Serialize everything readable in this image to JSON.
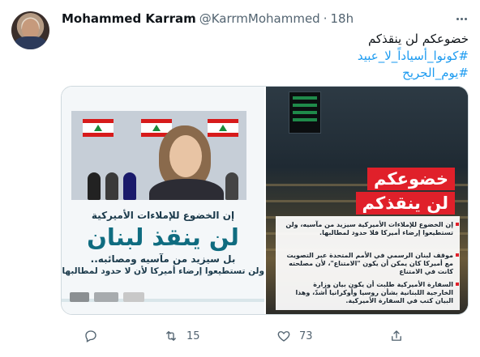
{
  "tweet": {
    "author_name": "Mohammed Karram",
    "handle": "@KarrmMohammed",
    "separator": "·",
    "time": "18h",
    "text_line1": "خضوعكم لن ينقذكم",
    "hashtag1": "#كونوا_أسياداً_لا_عبيد",
    "hashtag2": "#يوم_الجريح"
  },
  "media": {
    "left_panel": {
      "line1": "إن الخضوع للإملاءات الأميركية",
      "line2": "لن ينقذ لبنان",
      "line3": "بل سيزيد من مآسيه ومصائبه..",
      "line4": "ولن تستطيعوا إرضاء أميركا لأن لا حدود لمطالبها."
    },
    "right_panel": {
      "title_line1": "خضوعكم",
      "title_line2": "لن ينقذكم",
      "item1": "إن الخضوع للإملاءات الأميركية سيزيد من مآسيه، ولن تستطيعوا إرضاء أميركا فلا حدود لمطالبها.",
      "item2": "موقف لبنان الرسمي في الأمم المتحدة عبر التصويت مع أميركا كان يمكن أن يكون \"الامتناع\"، لأن مصلحته كانت في الامتناع",
      "item3": "السفارة الأميركية طلبت أن يكون بيان وزارة الخارجية اللبنانية بشأن روسيا وأوكرانيا أشدّ، وهذا البيان كتب في السفارة الأميركية."
    }
  },
  "actions": {
    "reply_count": "",
    "retweet_count": "15",
    "like_count": "73"
  },
  "icons": {
    "more": "more-horizontal-icon",
    "reply": "reply-icon",
    "retweet": "retweet-icon",
    "like": "heart-icon",
    "share": "share-icon"
  },
  "colors": {
    "hashtag": "#1d9bf0",
    "muted": "#536471",
    "accent_red": "#e0202a",
    "teal": "#0f6c80"
  }
}
